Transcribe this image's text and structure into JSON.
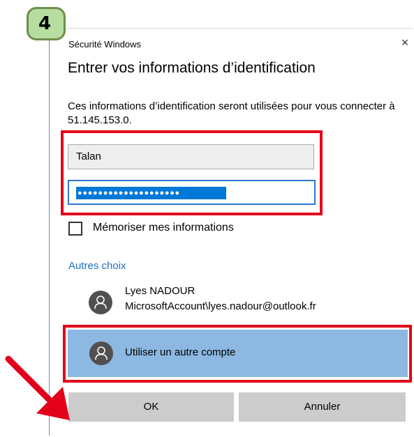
{
  "step": {
    "number": "4"
  },
  "window": {
    "title": "Sécurité Windows",
    "close_glyph": "×",
    "heading": "Entrer vos informations d’identification",
    "description": "Ces informations d’identification seront utilisées pour vous connecter à 51.145.153.0."
  },
  "credentials": {
    "username_value": "Talan",
    "password_mask": "●●●●●●●●●●●●●●●●●●●●"
  },
  "remember": {
    "label": "Mémoriser mes informations",
    "checked": false
  },
  "other_choices": {
    "label": "Autres choix",
    "accounts": [
      {
        "name": "Lyes NADOUR",
        "id": "MicrosoftAccount\\lyes.nadour@outlook.fr",
        "icon": "person-icon"
      }
    ],
    "other_account_label": "Utiliser un autre compte"
  },
  "buttons": {
    "ok_label": "OK",
    "cancel_label": "Annuler"
  },
  "colors": {
    "highlight": "#e3001b",
    "selection": "#0078d7",
    "selected_row": "#8cb8e2",
    "link": "#1e73be",
    "badge_fill": "#b7dea0"
  }
}
